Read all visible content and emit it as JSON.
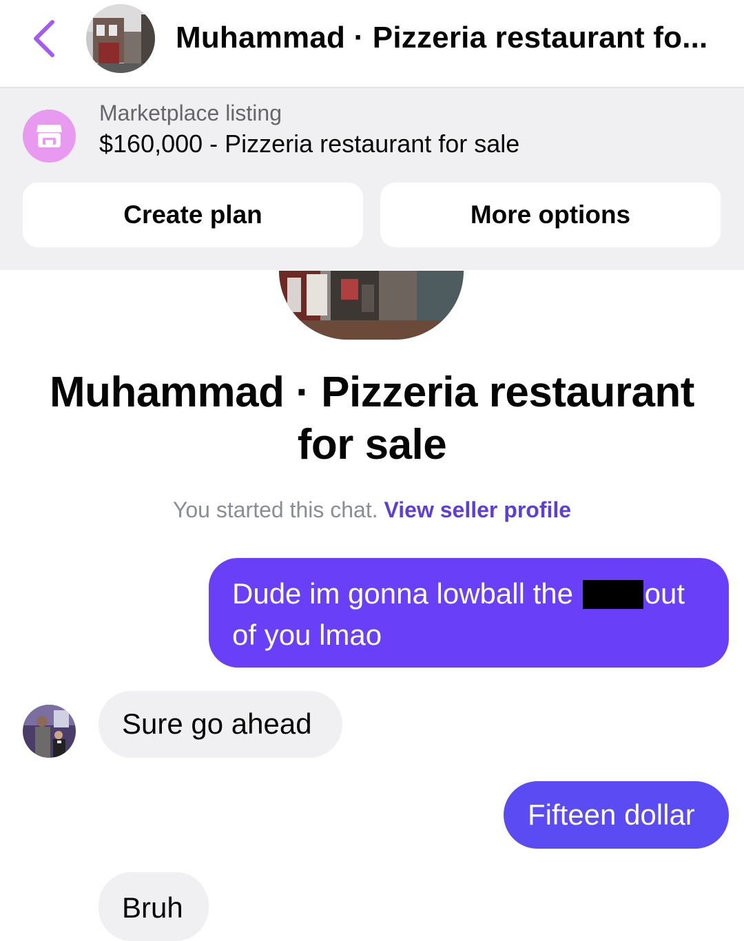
{
  "header": {
    "back_icon": "chevron-left-icon",
    "title": "Muhammad · Pizzeria restaurant fo..."
  },
  "listing": {
    "icon": "shop-icon",
    "label": "Marketplace listing",
    "description": "$160,000 - Pizzeria restaurant for sale",
    "create_plan_label": "Create plan",
    "more_options_label": "More options"
  },
  "conversation": {
    "title": "Muhammad · Pizzeria restaurant for sale",
    "started_text": "You started this chat.",
    "seller_link": "View seller profile"
  },
  "messages": [
    {
      "from": "me",
      "text_before": "Dude im gonna lowball the",
      "text_after": "out",
      "text_line2": "of you lmao",
      "redacted": true
    },
    {
      "from": "seller",
      "text": "Sure go ahead"
    },
    {
      "from": "me",
      "text": "Fifteen dollar"
    },
    {
      "from": "seller",
      "text": "Bruh"
    }
  ],
  "colors": {
    "accent": "#6a3ff8",
    "link": "#5b3fd8",
    "shop_icon_bg": "#e79af0",
    "banner_bg": "#f0f0f2",
    "received_bubble": "#f0f0f2"
  }
}
